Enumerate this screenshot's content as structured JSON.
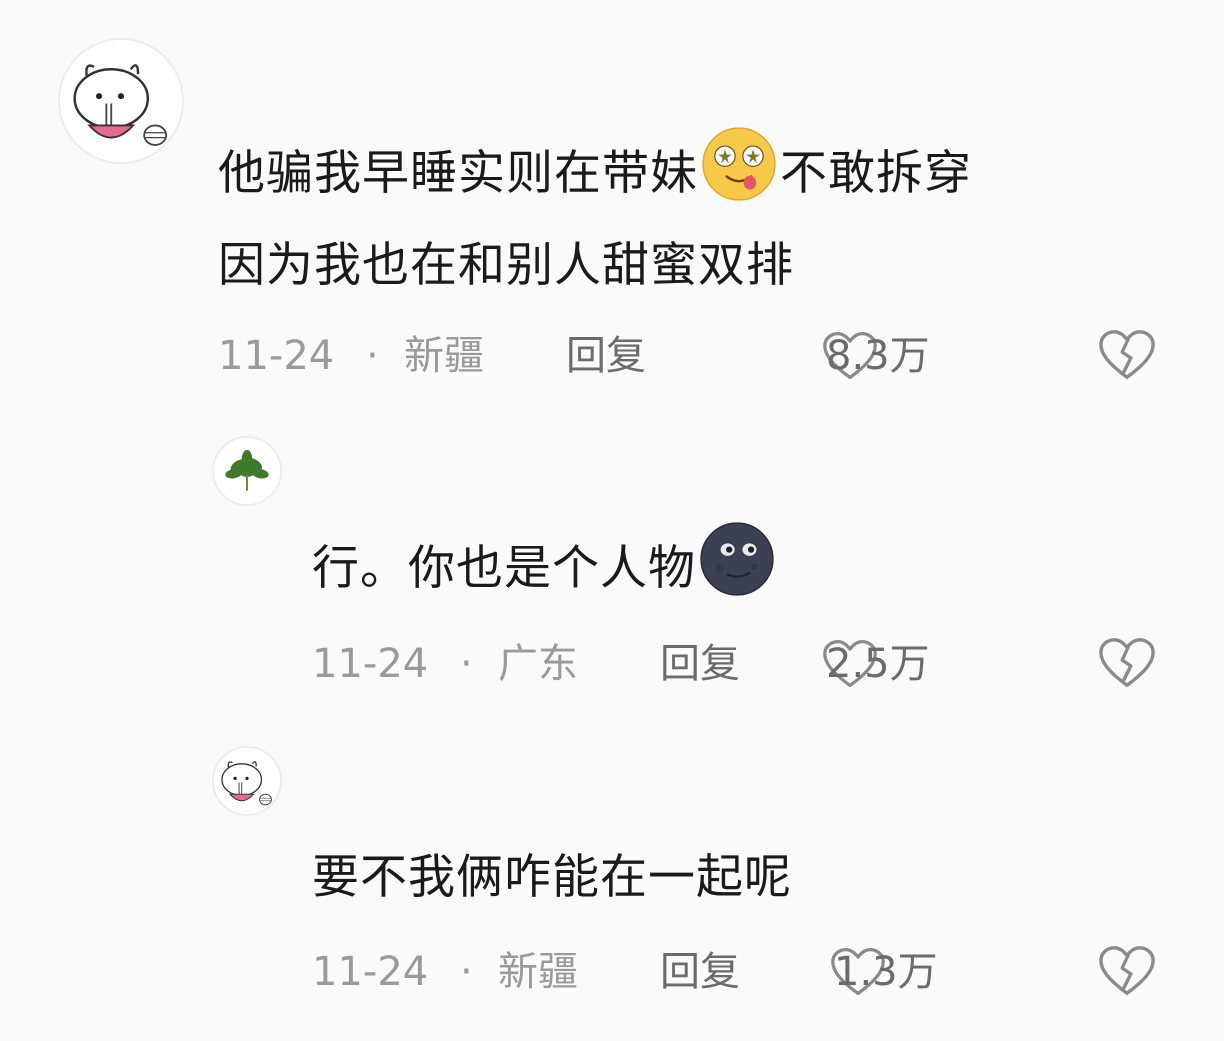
{
  "comments": [
    {
      "text_before": "他骗我早睡实则在带妹",
      "emoji": "drooling-face-emoji",
      "text_after": "不敢拆穿\n因为我也在和别人甜蜜双排",
      "date": "11-24",
      "separator": "·",
      "location": "新疆",
      "reply_label": "回复",
      "likes": "8.3万",
      "avatar": "bunny-eating-noodles"
    },
    {
      "text_before": "行。你也是个人物",
      "emoji": "new-moon-face-emoji",
      "text_after": "",
      "date": "11-24",
      "separator": "·",
      "location": "广东",
      "reply_label": "回复",
      "likes": "2.5万",
      "avatar": "green-leaves"
    },
    {
      "text_before": "要不我俩咋能在一起呢",
      "emoji": "",
      "text_after": "",
      "date": "11-24",
      "separator": "·",
      "location": "新疆",
      "reply_label": "回复",
      "likes": "1.3万",
      "avatar": "bunny-eating-noodles"
    }
  ],
  "colors": {
    "background": "#fafafa",
    "text": "#1a1a1a",
    "meta": "#9a9a9a",
    "reply": "#6b6b6b"
  }
}
